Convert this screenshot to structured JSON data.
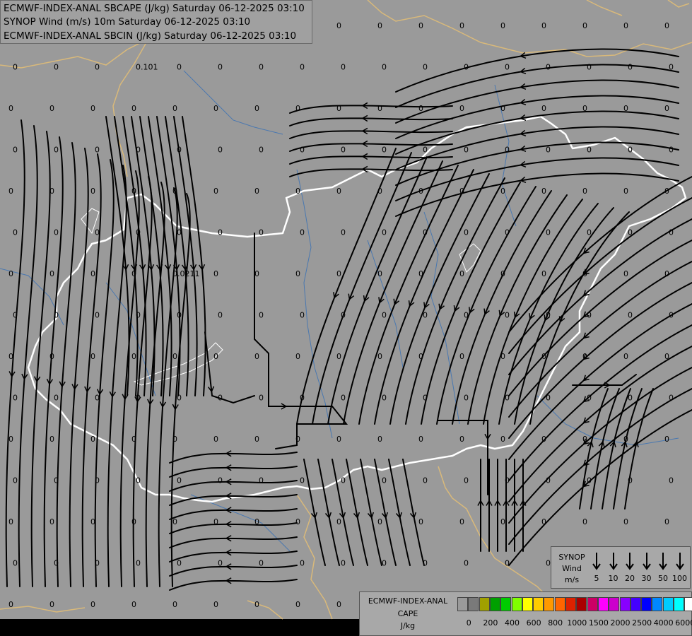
{
  "header": {
    "line1": "ECMWF-INDEX-ANAL SBCAPE (J/kg) Saturday 06-12-2025 03:10",
    "line2": "SYNOP Wind (m/s) 10m Saturday 06-12-2025 03:10",
    "line3": "ECMWF-INDEX-ANAL SBCIN (J/kg) Saturday 06-12-2025 03:10"
  },
  "map": {
    "background_color": "#9a9a9a",
    "border_color": "#ffffff",
    "region_border_color": "#d9b97a",
    "river_color": "#4a78b0",
    "streamline_color": "#000000",
    "grid_value": "0",
    "special_values": [
      "0.101",
      "0.0211"
    ]
  },
  "wind_legend": {
    "title": "SYNOP",
    "subtitle": "Wind",
    "unit": "m/s",
    "speeds": [
      "5",
      "10",
      "20",
      "30",
      "50",
      "100"
    ]
  },
  "cape_legend": {
    "title": "ECMWF-INDEX-ANAL",
    "subtitle": "CAPE",
    "unit": "J/kg",
    "colors": [
      "#9a9a9a",
      "#7a7a7a",
      "#a0a000",
      "#00a000",
      "#00cc00",
      "#80ff00",
      "#ffff00",
      "#ffcc00",
      "#ff9900",
      "#ff6600",
      "#dd2200",
      "#aa0000",
      "#cc0066",
      "#ff00ff",
      "#cc00cc",
      "#8800ff",
      "#4400ff",
      "#0000ff",
      "#0088ff",
      "#00ccff",
      "#00ffff",
      "#ffffff"
    ],
    "ticks": [
      "0",
      "200",
      "400",
      "600",
      "800",
      "1000",
      "1500",
      "2000",
      "2500",
      "4000",
      "6000"
    ]
  }
}
